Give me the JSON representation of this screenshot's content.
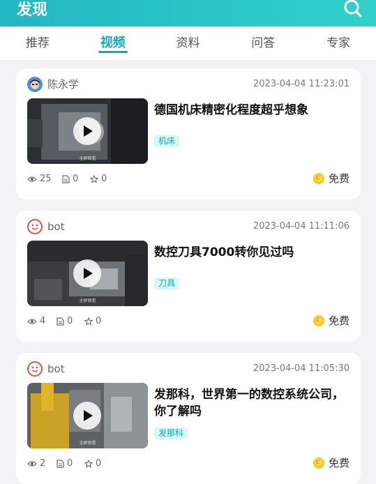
{
  "header": {
    "title": "发现",
    "search_icon": "search-icon"
  },
  "tabs": [
    {
      "label": "推荐",
      "active": false
    },
    {
      "label": "视频",
      "active": true
    },
    {
      "label": "资料",
      "active": false
    },
    {
      "label": "问答",
      "active": false
    },
    {
      "label": "专家",
      "active": false
    }
  ],
  "colors": {
    "header_start": "#22b8c4",
    "header_end": "#33d0cb",
    "accent": "#16a9b6",
    "tag_bg": "#d9f7f6",
    "coin": "#f8c21a"
  },
  "videos": [
    {
      "author": "陈永学",
      "avatar": "user-avatar-icon",
      "time": "2023-04-04 11:23:01",
      "title": "德国机床精密化程度超乎想象",
      "tag": "机床",
      "views": "25",
      "docs": "0",
      "stars": "0",
      "price": "免费",
      "thumb_caption": "全屏观看"
    },
    {
      "author": "bot",
      "avatar": "bot-avatar-icon",
      "time": "2023-04-04 11:11:06",
      "title": "数控刀具7000转你见过吗",
      "tag": "刀具",
      "views": "4",
      "docs": "0",
      "stars": "0",
      "price": "免费",
      "thumb_caption": "全屏观看"
    },
    {
      "author": "bot",
      "avatar": "bot-avatar-icon",
      "time": "2023-04-04 11:05:30",
      "title": "发那科，世界第一的数控系统公司，你了解吗",
      "tag": "发那科",
      "views": "2",
      "docs": "0",
      "stars": "0",
      "price": "免费",
      "thumb_caption": "全屏观看"
    }
  ]
}
